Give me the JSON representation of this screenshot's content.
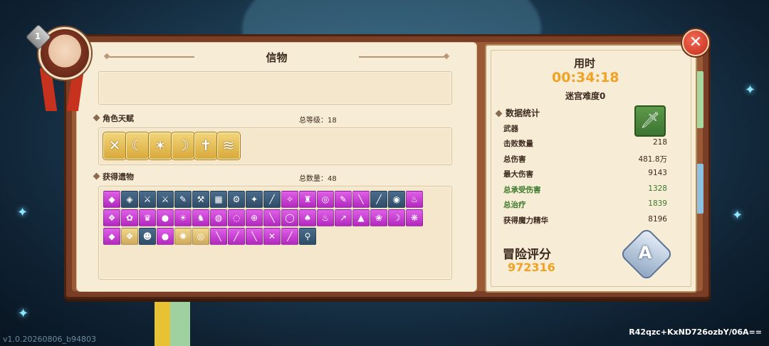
{
  "left": {
    "title": "信物",
    "talent_label": "角色天赋",
    "talent_total": "总等级：18",
    "relic_label": "获得遗物",
    "relic_total": "总数量：48"
  },
  "right": {
    "time_label": "用时",
    "time_value": "00:34:18",
    "difficulty": "迷宫难度0",
    "stats_label": "数据统计",
    "stats": [
      {
        "label": "武器",
        "value": ""
      },
      {
        "label": "击败数量",
        "value": "218"
      },
      {
        "label": "总伤害",
        "value": "481.8万"
      },
      {
        "label": "最大伤害",
        "value": "9143"
      },
      {
        "label": "总承受伤害",
        "value": "1328"
      },
      {
        "label": "总治疗",
        "value": "1839"
      },
      {
        "label": "获得魔力精华",
        "value": "8196"
      }
    ],
    "score_label": "冒险评分",
    "score_value": "972316",
    "grade": "A"
  },
  "player": {
    "level": "1"
  },
  "footer": {
    "version": "v1.0.20260806_b94803",
    "uid": "R42qzc+KxND726ozbY/06A=="
  },
  "icons": {
    "close": "close-icon",
    "weapon": "sword-icon"
  },
  "colors": {
    "accent_orange": "#f0a224",
    "stat_green": "#3b7a2a",
    "relic_purple": "#c13ad0",
    "close_red": "#d8402a"
  }
}
